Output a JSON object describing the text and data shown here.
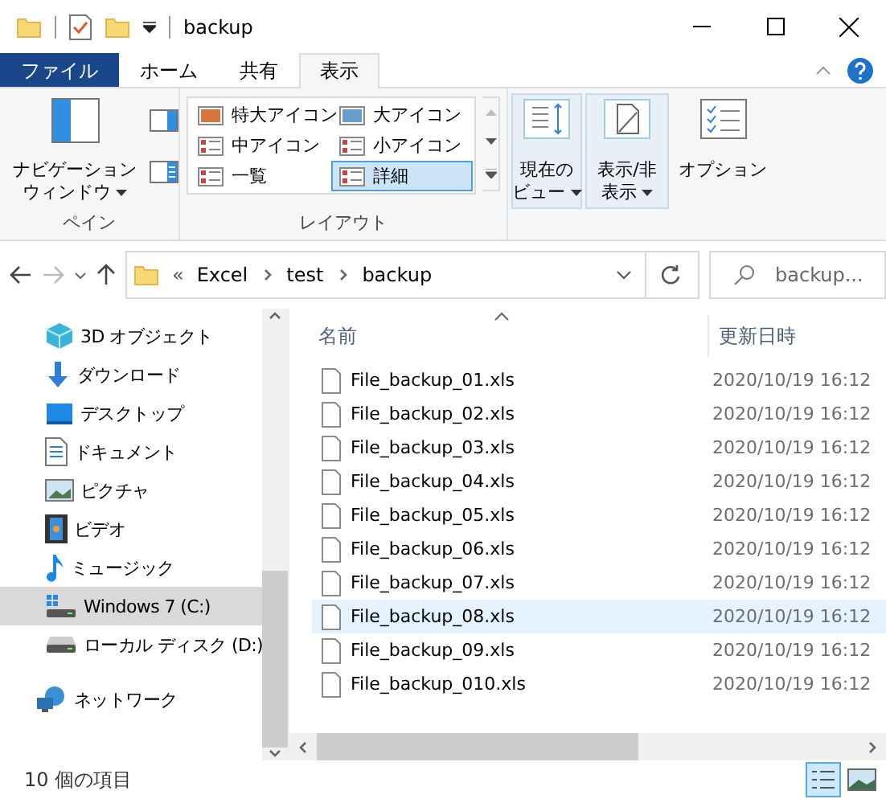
{
  "title_bar": {
    "title": "backup"
  },
  "ribbon_tabs": [
    {
      "label": "ファイル",
      "kind": "file",
      "selected": false
    },
    {
      "label": "ホーム",
      "kind": "tab",
      "selected": false
    },
    {
      "label": "共有",
      "kind": "tab",
      "selected": false
    },
    {
      "label": "表示",
      "kind": "tab",
      "selected": true
    }
  ],
  "pane_group": {
    "label": "ペイン",
    "navigation_pane": [
      "ナビゲーション",
      "ウィンドウ"
    ]
  },
  "layout_group": {
    "label": "レイアウト",
    "options": [
      {
        "label": "特大アイコン",
        "selected": false
      },
      {
        "label": "大アイコン",
        "selected": false
      },
      {
        "label": "中アイコン",
        "selected": false
      },
      {
        "label": "小アイコン",
        "selected": false
      },
      {
        "label": "一覧",
        "selected": false
      },
      {
        "label": "詳細",
        "selected": true
      }
    ]
  },
  "current_view": [
    "現在の",
    "ビュー"
  ],
  "show_hide": [
    "表示/非",
    "表示"
  ],
  "options_button": "オプション",
  "address": {
    "prefix": "«",
    "path": [
      "Excel",
      "test",
      "backup"
    ]
  },
  "search": {
    "placeholder": "backup..."
  },
  "nav_items": [
    {
      "label": "3D オブジェクト",
      "kind": "cube",
      "selected": false
    },
    {
      "label": "ダウンロード",
      "kind": "download",
      "selected": false
    },
    {
      "label": "デスクトップ",
      "kind": "desktop",
      "selected": false
    },
    {
      "label": "ドキュメント",
      "kind": "document",
      "selected": false
    },
    {
      "label": "ピクチャ",
      "kind": "picture",
      "selected": false
    },
    {
      "label": "ビデオ",
      "kind": "video",
      "selected": false
    },
    {
      "label": "ミュージック",
      "kind": "music",
      "selected": false
    },
    {
      "label": "Windows 7 (C:)",
      "kind": "system-drive",
      "selected": true
    },
    {
      "label": "ローカル ディスク (D:)",
      "kind": "drive",
      "selected": false
    }
  ],
  "nav_network": {
    "label": "ネットワーク"
  },
  "columns": [
    "名前",
    "更新日時"
  ],
  "rows": [
    {
      "name": "File_backup_01.xls",
      "modified": "2020/10/19 16:12",
      "selected": false
    },
    {
      "name": "File_backup_02.xls",
      "modified": "2020/10/19 16:12",
      "selected": false
    },
    {
      "name": "File_backup_03.xls",
      "modified": "2020/10/19 16:12",
      "selected": false
    },
    {
      "name": "File_backup_04.xls",
      "modified": "2020/10/19 16:12",
      "selected": false
    },
    {
      "name": "File_backup_05.xls",
      "modified": "2020/10/19 16:12",
      "selected": false
    },
    {
      "name": "File_backup_06.xls",
      "modified": "2020/10/19 16:12",
      "selected": false
    },
    {
      "name": "File_backup_07.xls",
      "modified": "2020/10/19 16:12",
      "selected": false
    },
    {
      "name": "File_backup_08.xls",
      "modified": "2020/10/19 16:12",
      "selected": true
    },
    {
      "name": "File_backup_09.xls",
      "modified": "2020/10/19 16:12",
      "selected": false
    },
    {
      "name": "File_backup_010.xls",
      "modified": "2020/10/19 16:12",
      "selected": false
    }
  ],
  "status_bar": {
    "item_count": "10 個の項目"
  },
  "view_modes": [
    {
      "kind": "details",
      "selected": true
    },
    {
      "kind": "tiles",
      "selected": false
    }
  ]
}
